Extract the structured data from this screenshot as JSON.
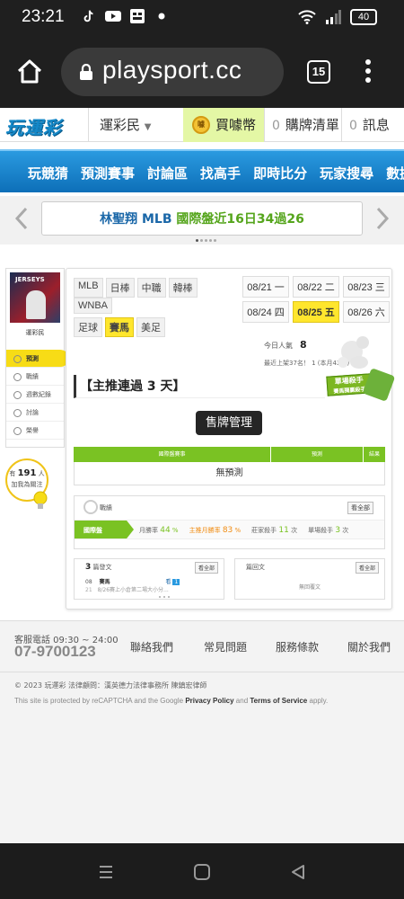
{
  "status_bar": {
    "time": "23:21",
    "battery": "40",
    "notification_icons": [
      "tiktok-icon",
      "youtube-icon",
      "app-icon",
      "dot-icon"
    ]
  },
  "browser": {
    "url": "playsport.cc",
    "tab_count": "15"
  },
  "site_nav": {
    "logo": "玩運彩",
    "lotto_menu": "運彩民",
    "buy_coin": "買噱幣",
    "coin_badge": "噱",
    "cart_count": "0",
    "cart_label": "購牌清單",
    "msg_count": "0",
    "msg_label": "訊息"
  },
  "blue_menu": [
    "玩競猜",
    "預測賽事",
    "討論區",
    "找高手",
    "即時比分",
    "玩家搜尋",
    "數據"
  ],
  "banner": {
    "name": "林聖翔",
    "league": "MLB",
    "text": "國際盤近16日34過26",
    "active_dot": 1,
    "dot_count": 5
  },
  "profile": {
    "avatar_caption": "JERSEYS",
    "username": "運彩民",
    "menu": [
      {
        "label": "預測",
        "icon": "bulb-icon",
        "active": true
      },
      {
        "label": "戰績",
        "icon": "chart-icon",
        "active": false
      },
      {
        "label": "週數紀錄",
        "icon": "record-icon",
        "active": false
      },
      {
        "label": "討論",
        "icon": "chat-icon",
        "active": false
      },
      {
        "label": "榮譽",
        "icon": "trophy-icon",
        "active": false
      }
    ],
    "fans_prefix": "有",
    "fans_count": "191",
    "fans_unit": "人",
    "fans_text": "加我為關注"
  },
  "main": {
    "sport_tags_row1": [
      "MLB",
      "日棒",
      "中職",
      "韓棒"
    ],
    "sport_tags_row2": [
      "WNBA"
    ],
    "sport_tags_row3": [
      "足球",
      "賽馬",
      "美足"
    ],
    "active_sport": "賽馬",
    "dates": [
      {
        "date": "08/21",
        "day": "一",
        "active": false
      },
      {
        "date": "08/22",
        "day": "二",
        "active": false
      },
      {
        "date": "08/23",
        "day": "三",
        "active": false
      },
      {
        "date": "08/24",
        "day": "四",
        "active": false
      },
      {
        "date": "08/25",
        "day": "五",
        "active": true
      },
      {
        "date": "08/26",
        "day": "六",
        "active": false
      }
    ],
    "today_pop_label": "今日人氣",
    "today_pop_value": "8",
    "last_listing": "最近上架37名！ 1 (本月42名)",
    "killer_sign": "單場殺手",
    "killer_sub": "賽馬獨贏殺手",
    "headline": "【主推連過 3 天】",
    "manage_button": "售牌管理",
    "table_headers": [
      "國際盤賽事",
      "預測",
      "結果"
    ],
    "table_empty": "無預測",
    "perf_label": "戰績",
    "perf_all": "看全部",
    "perf_strip": [
      {
        "label": "國際盤",
        "value": ""
      },
      {
        "label": "月勝率",
        "value": "44",
        "unit": "%"
      },
      {
        "label": "主推月勝率",
        "value": "83",
        "unit": "%"
      },
      {
        "label": "莊家殺手",
        "value": "11",
        "unit": "次"
      },
      {
        "label": "單場殺手",
        "value": "3",
        "unit": "次"
      }
    ],
    "posts_count": "3",
    "posts_label": "篇發文",
    "posts_all": "看全部",
    "post_item_date": "08",
    "post_item_day": "21",
    "post_item_title": "賽馬",
    "post_item_text": "8/26賽上小倉第二場大小分...",
    "post_item_tag": "1",
    "replies_label": "篇回文",
    "replies_all": "看全部",
    "replies_empty": "無回覆文"
  },
  "footer": {
    "phone_label": "客服電話 09:30 ~ 24:00",
    "phone": "07-9700123",
    "links": [
      "聯絡我們",
      "常見問題",
      "服務條款",
      "關於我們"
    ],
    "copyright": "© 2023 玩運彩 法律顧問：漢英德力法律事務所 陳鎮宏律師",
    "recaptcha_prefix": "This site is protected by reCAPTCHA and the Google ",
    "privacy": "Privacy Policy",
    "and": " and ",
    "terms": "Terms of Service",
    "apply": " apply."
  },
  "colors": {
    "accent_blue": "#1488c8",
    "accent_green": "#7ac223",
    "accent_yellow": "#ffe62d",
    "status_bar": "#1f1f1f"
  }
}
